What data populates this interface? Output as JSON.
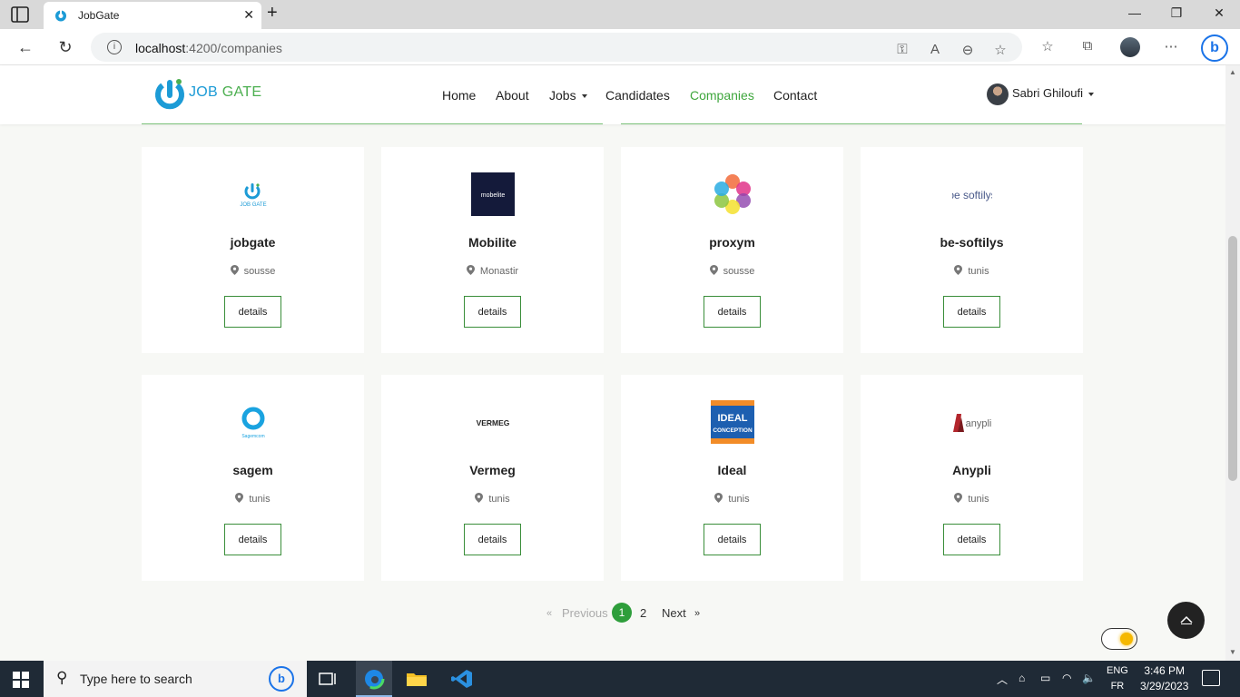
{
  "browser": {
    "tab_title": "JobGate",
    "url_host": "localhost",
    "url_path": ":4200/companies"
  },
  "site": {
    "logo_text_job": "JOB",
    "logo_text_gate": "GATE",
    "nav": [
      "Home",
      "About",
      "Jobs",
      "Candidates",
      "Companies",
      "Contact"
    ],
    "active_nav": "Companies",
    "user_name": "Sabri Ghiloufi"
  },
  "companies": [
    {
      "name": "jobgate",
      "location": "sousse",
      "button": "details"
    },
    {
      "name": "Mobilite",
      "location": "Monastir",
      "button": "details"
    },
    {
      "name": "proxym",
      "location": "sousse",
      "button": "details"
    },
    {
      "name": "be-softilys",
      "location": "tunis",
      "button": "details"
    },
    {
      "name": "sagem",
      "location": "tunis",
      "button": "details"
    },
    {
      "name": "Vermeg",
      "location": "tunis",
      "button": "details"
    },
    {
      "name": "Ideal",
      "location": "tunis",
      "button": "details"
    },
    {
      "name": "Anypli",
      "location": "tunis",
      "button": "details"
    }
  ],
  "logos": {
    "jobgate": "JOB GATE",
    "mobilite": "mobelite",
    "besoftilys": "be softilys",
    "sagem": "Sagemcom",
    "vermeg": "VERMEG",
    "ideal_1": "IDEAL",
    "ideal_2": "CONCEPTION",
    "anypli": "anypli"
  },
  "pagination": {
    "prev_arrow": "«",
    "previous": "Previous",
    "page_1": "1",
    "page_2": "2",
    "next": "Next",
    "next_arrow": "»"
  },
  "taskbar": {
    "search_placeholder": "Type here to search",
    "lang_top": "ENG",
    "lang_bottom": "FR",
    "time": "3:46 PM",
    "date": "3/29/2023"
  },
  "colors": {
    "brand_blue": "#1c9bd6",
    "brand_green": "#3ea63c",
    "button_border": "#3a8e3a"
  }
}
